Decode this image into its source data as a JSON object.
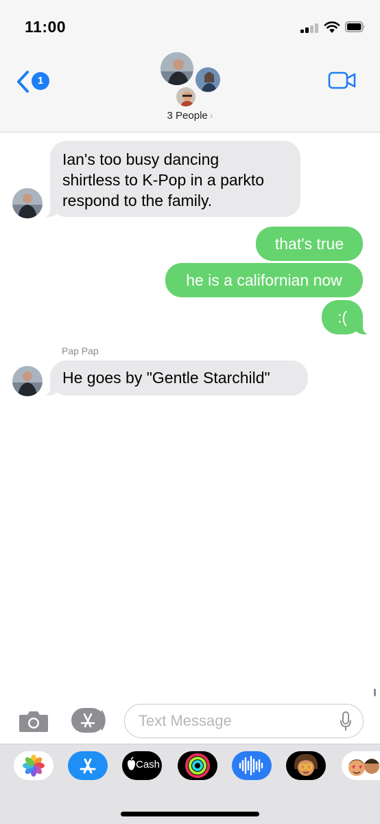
{
  "status_bar": {
    "time": "11:00",
    "signal_bars_filled": 2,
    "signal_bars_total": 4,
    "icons": [
      "cellular-signal-icon",
      "wifi-icon",
      "battery-icon"
    ]
  },
  "header": {
    "back_badge_count": "1",
    "group_label": "3 People",
    "chevron": "›",
    "icons": [
      "back-chevron-icon",
      "video-camera-icon"
    ]
  },
  "messages": [
    {
      "direction": "received",
      "lines": [
        "Ian's too busy dancing",
        "shirtless to K-Pop in a parkto",
        "respond to the family."
      ]
    },
    {
      "direction": "sent",
      "text": "that's true"
    },
    {
      "direction": "sent",
      "text": "he is a californian now"
    },
    {
      "direction": "sent",
      "text": ":("
    },
    {
      "direction": "received",
      "sender": "Pap Pap",
      "text": "He goes by \"Gentle Starchild\""
    }
  ],
  "composer": {
    "placeholder": "Text Message",
    "value": "",
    "icons": [
      "camera-icon",
      "app-store-icon",
      "microphone-icon"
    ]
  },
  "app_drawer": {
    "apps": [
      {
        "name": "photos",
        "label": ""
      },
      {
        "name": "app-store",
        "label": ""
      },
      {
        "name": "apple-cash",
        "label": "Cash"
      },
      {
        "name": "activity",
        "label": ""
      },
      {
        "name": "audio-message",
        "label": ""
      },
      {
        "name": "memoji",
        "label": ""
      },
      {
        "name": "memoji-stickers",
        "label": ""
      }
    ]
  },
  "colors": {
    "accent": "#1f7ef5",
    "sent_bubble": "#65d36e",
    "received_bubble": "#e9e9eb",
    "bar_background": "#f6f6f6",
    "drawer_background": "#e3e3e6"
  }
}
